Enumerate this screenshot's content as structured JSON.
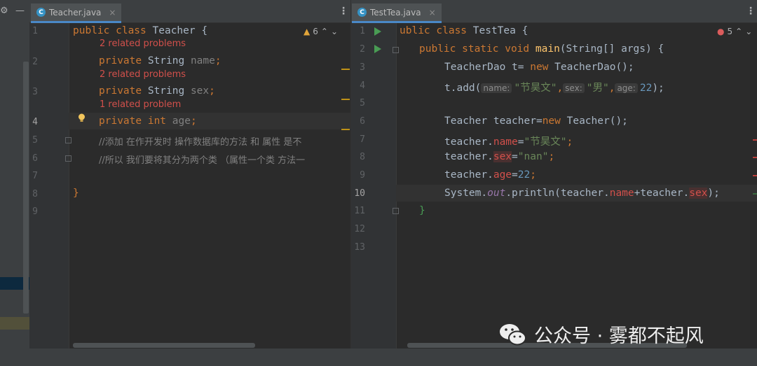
{
  "left_editor": {
    "tab_label": "Teacher.java",
    "tab_icon": "class-icon",
    "tab_icon_letter": "C",
    "warnings_count": "6",
    "gutter_numbers": [
      "1",
      "2",
      "3",
      "4",
      "5",
      "6",
      "7",
      "8",
      "9"
    ],
    "problems": [
      "2 related problems",
      "2 related problems",
      "1 related problem"
    ],
    "code": {
      "l1_kw": "public class ",
      "l1_name": "Teacher {",
      "l2_kw": "private ",
      "l2_type": "String ",
      "l2_field": "name",
      "l2_end": ";",
      "l3_kw": "private ",
      "l3_type": "String ",
      "l3_field": "sex",
      "l3_end": ";",
      "l4_kw": "private int ",
      "l4_field": "age",
      "l4_end": ";",
      "l5_comment": "//添加 在作开发时 操作数据库的方法 和 属性 是不",
      "l6_comment": "//所以 我们要将其分为两个类 （属性一个类 方法一",
      "l8_brace": "}"
    }
  },
  "right_editor": {
    "tab_label": "TestTea.java",
    "tab_icon": "class-run-icon",
    "tab_icon_letter": "C",
    "errors_count": "5",
    "gutter_numbers": [
      "1",
      "2",
      "3",
      "4",
      "5",
      "6",
      "7",
      "8",
      "9",
      "10",
      "11",
      "12",
      "13"
    ],
    "code": {
      "l1_kw": "ublic class ",
      "l1_name": "TestTea {",
      "l2_kw": "public static void ",
      "l2_fn": "main",
      "l2_rest": "(String[] args) {",
      "l3_a": "TeacherDao t= ",
      "l3_kw": "new ",
      "l3_b": "TeacherDao();",
      "l4_a": "t.add(",
      "l4_hint1": "name:",
      "l4_str1": "\"节昊文\"",
      "l4_c1": ",",
      "l4_hint2": "sex:",
      "l4_str2": "\"男\"",
      "l4_c2": ",",
      "l4_hint3": "age:",
      "l4_num": "22",
      "l4_end": ");",
      "l6_a": "Teacher teacher=",
      "l6_kw": "new ",
      "l6_b": "Teacher();",
      "l7_a": "teacher.",
      "l7_f": "name",
      "l7_eq": "=",
      "l7_s": "\"节昊文\"",
      "l7_end": ";",
      "l8_a": "teacher.",
      "l8_f": "sex",
      "l8_eq": "=",
      "l8_s": "\"nan\"",
      "l8_end": ";",
      "l9_a": "teacher.",
      "l9_f": "age",
      "l9_eq": "=",
      "l9_n": "22",
      "l9_end": ";",
      "l10_a": "System.",
      "l10_out": "out",
      "l10_b": ".println(teacher.",
      "l10_f1": "name",
      "l10_c": "+teacher.",
      "l10_f2": "sex",
      "l10_end": ");",
      "l11_brace": "}"
    }
  },
  "watermark": {
    "text": "公众号 · 雾都不起风",
    "icon": "wechat-icon"
  },
  "colors": {
    "keyword": "#cc7832",
    "string": "#6a8759",
    "number": "#6897bb",
    "field": "#9876aa",
    "error_text": "#d2504b",
    "run_arrow": "#499c54"
  }
}
